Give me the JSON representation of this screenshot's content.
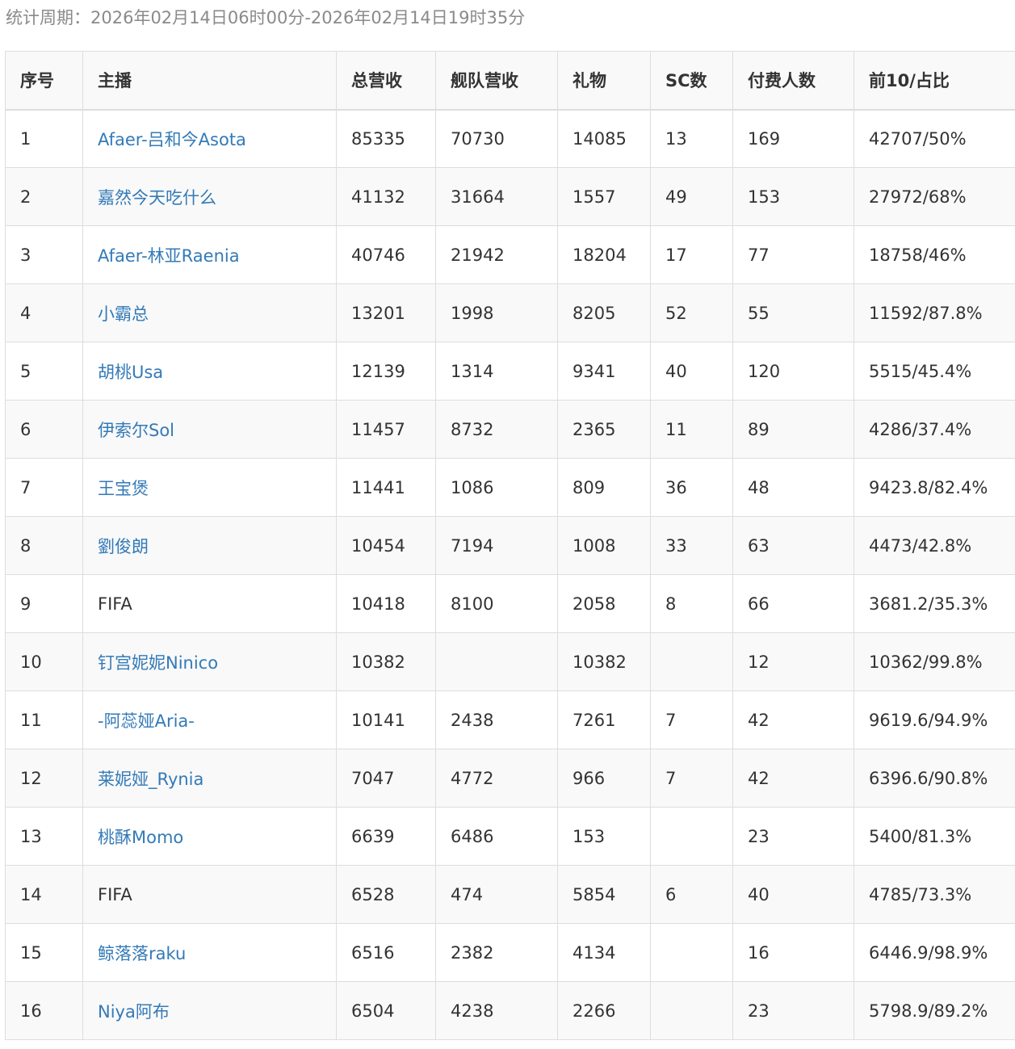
{
  "period": {
    "label": "统计周期：",
    "value": "2026年02月14日06时00分-2026年02月14日19时35分"
  },
  "table": {
    "headers": [
      "序号",
      "主播",
      "总营收",
      "舰队营收",
      "礼物",
      "SC数",
      "付费人数",
      "前10/占比"
    ],
    "rows": [
      {
        "rank": "1",
        "streamer": "Afaer-吕和今Asota",
        "link": true,
        "total": "85335",
        "fleet": "70730",
        "gift": "14085",
        "sc": "13",
        "payers": "169",
        "top10": "42707/50%"
      },
      {
        "rank": "2",
        "streamer": "嘉然今天吃什么",
        "link": true,
        "total": "41132",
        "fleet": "31664",
        "gift": "1557",
        "sc": "49",
        "payers": "153",
        "top10": "27972/68%"
      },
      {
        "rank": "3",
        "streamer": "Afaer-林亚Raenia",
        "link": true,
        "total": "40746",
        "fleet": "21942",
        "gift": "18204",
        "sc": "17",
        "payers": "77",
        "top10": "18758/46%"
      },
      {
        "rank": "4",
        "streamer": "小霸总",
        "link": true,
        "total": "13201",
        "fleet": "1998",
        "gift": "8205",
        "sc": "52",
        "payers": "55",
        "top10": "11592/87.8%"
      },
      {
        "rank": "5",
        "streamer": "胡桃Usa",
        "link": true,
        "total": "12139",
        "fleet": "1314",
        "gift": "9341",
        "sc": "40",
        "payers": "120",
        "top10": "5515/45.4%"
      },
      {
        "rank": "6",
        "streamer": "伊索尔Sol",
        "link": true,
        "total": "11457",
        "fleet": "8732",
        "gift": "2365",
        "sc": "11",
        "payers": "89",
        "top10": "4286/37.4%"
      },
      {
        "rank": "7",
        "streamer": "王宝煲",
        "link": true,
        "total": "11441",
        "fleet": "1086",
        "gift": "809",
        "sc": "36",
        "payers": "48",
        "top10": "9423.8/82.4%"
      },
      {
        "rank": "8",
        "streamer": "劉俊朗",
        "link": true,
        "total": "10454",
        "fleet": "7194",
        "gift": "1008",
        "sc": "33",
        "payers": "63",
        "top10": "4473/42.8%"
      },
      {
        "rank": "9",
        "streamer": "FIFA",
        "link": false,
        "total": "10418",
        "fleet": "8100",
        "gift": "2058",
        "sc": "8",
        "payers": "66",
        "top10": "3681.2/35.3%"
      },
      {
        "rank": "10",
        "streamer": "钉宫妮妮Ninico",
        "link": true,
        "total": "10382",
        "fleet": "",
        "gift": "10382",
        "sc": "",
        "payers": "12",
        "top10": "10362/99.8%"
      },
      {
        "rank": "11",
        "streamer": "-阿蕊娅Aria-",
        "link": true,
        "total": "10141",
        "fleet": "2438",
        "gift": "7261",
        "sc": "7",
        "payers": "42",
        "top10": "9619.6/94.9%"
      },
      {
        "rank": "12",
        "streamer": "莱妮娅_Rynia",
        "link": true,
        "total": "7047",
        "fleet": "4772",
        "gift": "966",
        "sc": "7",
        "payers": "42",
        "top10": "6396.6/90.8%"
      },
      {
        "rank": "13",
        "streamer": "桃酥Momo",
        "link": true,
        "total": "6639",
        "fleet": "6486",
        "gift": "153",
        "sc": "",
        "payers": "23",
        "top10": "5400/81.3%"
      },
      {
        "rank": "14",
        "streamer": "FIFA",
        "link": false,
        "total": "6528",
        "fleet": "474",
        "gift": "5854",
        "sc": "6",
        "payers": "40",
        "top10": "4785/73.3%"
      },
      {
        "rank": "15",
        "streamer": "鲸落落raku",
        "link": true,
        "total": "6516",
        "fleet": "2382",
        "gift": "4134",
        "sc": "",
        "payers": "16",
        "top10": "6446.9/98.9%"
      },
      {
        "rank": "16",
        "streamer": "Niya阿布",
        "link": true,
        "total": "6504",
        "fleet": "4238",
        "gift": "2266",
        "sc": "",
        "payers": "23",
        "top10": "5798.9/89.2%"
      }
    ]
  },
  "colors": {
    "link": "#337ab7",
    "text": "#333333",
    "muted": "#8a8a8a",
    "border": "#dddddd",
    "stripe": "#f9f9f9"
  }
}
